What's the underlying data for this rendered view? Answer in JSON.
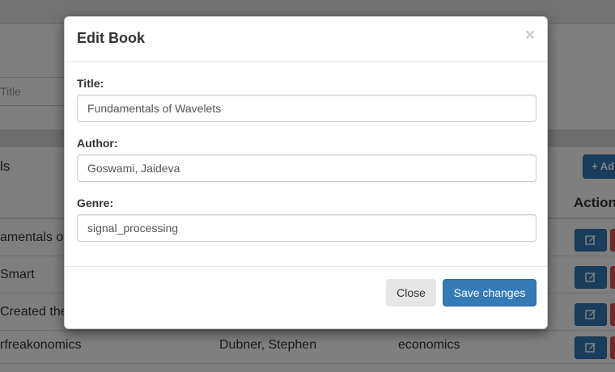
{
  "background": {
    "search_placeholder_fragment": "Title",
    "panel_title_fragment": "ls",
    "add_button_fragment": "+ Ad",
    "actions_header_fragment": "Action",
    "rows": [
      {
        "title": "amentals o",
        "author": "",
        "genre": ""
      },
      {
        "title": "Smart",
        "author": "",
        "genre": ""
      },
      {
        "title": "Created the",
        "author": "",
        "genre": ""
      },
      {
        "title": "rfreakonomics",
        "author": "Dubner, Stephen",
        "genre": "economics"
      }
    ]
  },
  "modal": {
    "title": "Edit Book",
    "close_symbol": "×",
    "fields": {
      "title": {
        "label": "Title:",
        "value": "Fundamentals of Wavelets"
      },
      "author": {
        "label": "Author:",
        "value": "Goswami, Jaideva"
      },
      "genre": {
        "label": "Genre:",
        "value": "signal_processing"
      }
    },
    "buttons": {
      "close": "Close",
      "save": "Save changes"
    }
  },
  "colors": {
    "primary": "#337ab7",
    "danger": "#d9534f",
    "backdrop": "rgba(0,0,0,0.5)"
  },
  "icons": {
    "edit": "edit-icon",
    "plus": "plus-icon",
    "close": "close-icon"
  }
}
